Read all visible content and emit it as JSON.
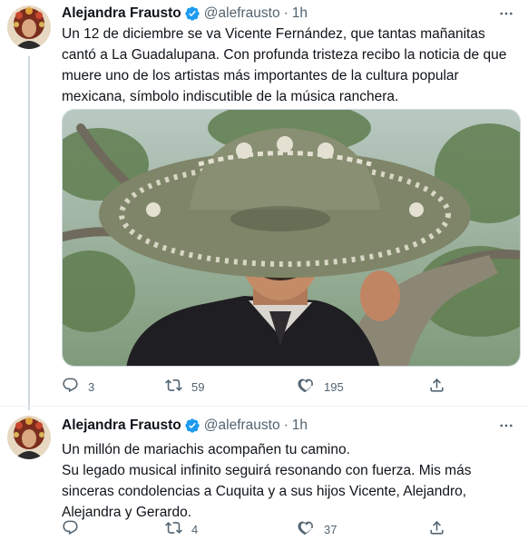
{
  "tweets": [
    {
      "author_name": "Alejandra Frausto",
      "handle": "@alefrausto",
      "separator": "·",
      "time": "1h",
      "text": "Un 12 de diciembre se va Vicente Fernández, que tantas mañanitas cantó a La Guadalupana. Con profunda tristeza recibo la noticia de que muere uno de los artistas más importantes de la cultura popular mexicana, símbolo indiscutible de la música ranchera.",
      "replies": "3",
      "retweets": "59",
      "likes": "195"
    },
    {
      "author_name": "Alejandra Frausto",
      "handle": "@alefrausto",
      "separator": "·",
      "time": "1h",
      "text": "Un millón de mariachis acompañen tu camino.\nSu legado musical infinito seguirá resonando con fuerza. Mis más sinceras condolencias a Cuquita y a sus hijos Vicente, Alejandro, Alejandra y Gerardo.",
      "replies": "",
      "retweets": "4",
      "likes": "37"
    }
  ],
  "icons": {
    "verified": "verified-badge-icon",
    "more": "more-icon",
    "reply": "reply-icon",
    "retweet": "retweet-icon",
    "like": "heart-icon",
    "share": "share-icon"
  },
  "colors": {
    "text": "#0f1419",
    "secondary": "#536471",
    "verified": "#1d9bf0",
    "border": "#eff3f4",
    "thread_line": "#cfd9de"
  }
}
